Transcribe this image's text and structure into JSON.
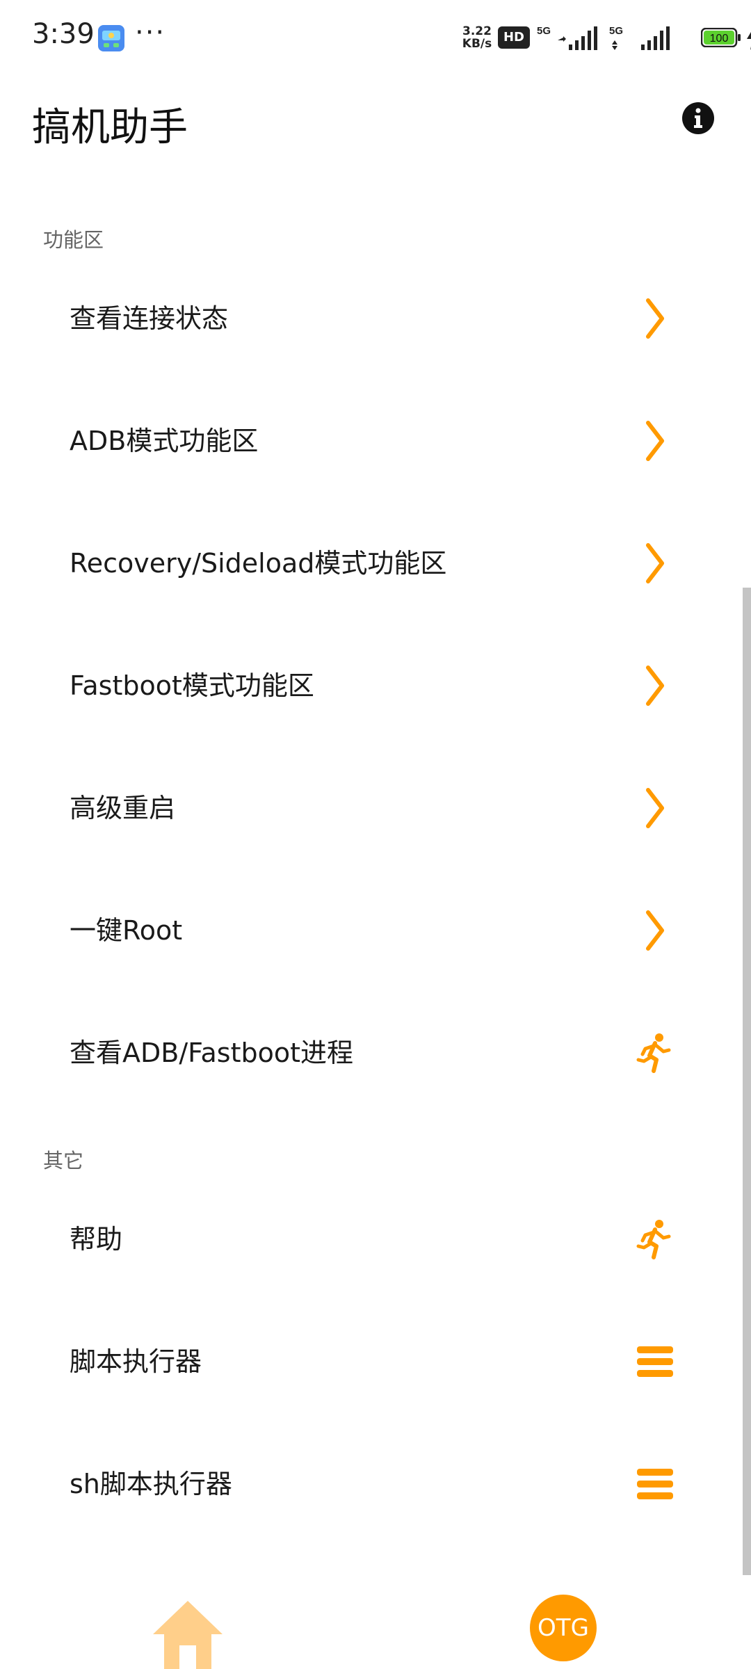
{
  "status_bar": {
    "time": "3:39",
    "more": "···",
    "net_speed_value": "3.22",
    "net_speed_unit": "KB/s",
    "hd": "HD",
    "signal_1": "5G",
    "signal_2": "5G",
    "battery": "100"
  },
  "header": {
    "title": "搞机助手",
    "info_icon": "info-icon"
  },
  "sections": [
    {
      "label": "功能区",
      "items": [
        {
          "label": "查看连接状态",
          "icon": "chevron-right-icon"
        },
        {
          "label": "ADB模式功能区",
          "icon": "chevron-right-icon"
        },
        {
          "label": "Recovery/Sideload模式功能区",
          "icon": "chevron-right-icon"
        },
        {
          "label": "Fastboot模式功能区",
          "icon": "chevron-right-icon"
        },
        {
          "label": "高级重启",
          "icon": "chevron-right-icon"
        },
        {
          "label": "一键Root",
          "icon": "chevron-right-icon"
        },
        {
          "label": "查看ADB/Fastboot进程",
          "icon": "running-person-icon"
        }
      ]
    },
    {
      "label": "其它",
      "items": [
        {
          "label": "帮助",
          "icon": "running-person-icon"
        },
        {
          "label": "脚本执行器",
          "icon": "menu-icon"
        },
        {
          "label": "sh脚本执行器",
          "icon": "menu-icon"
        }
      ]
    }
  ],
  "bottom_nav": {
    "home_icon": "home-icon",
    "otg_label": "OTG"
  },
  "colors": {
    "accent": "#FF9A00",
    "accent_light": "#FFCF8A",
    "battery_fill": "#5CD12E"
  }
}
